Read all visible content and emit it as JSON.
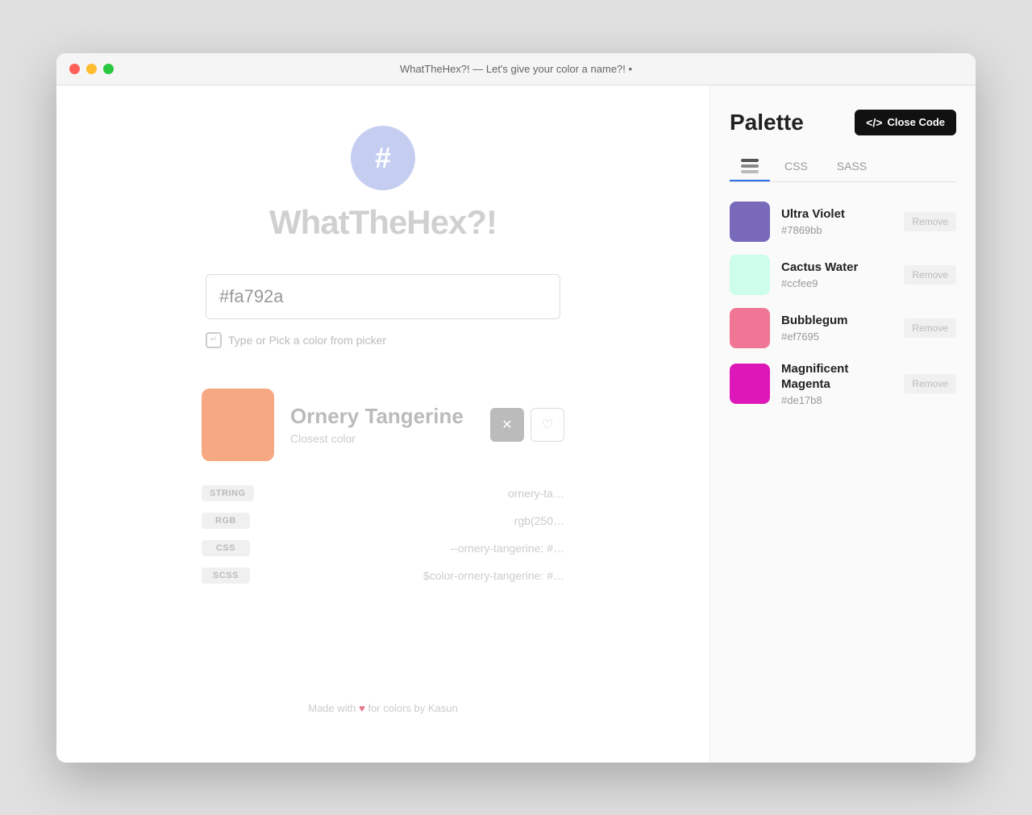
{
  "window": {
    "title": "WhatTheHex?! — Let's give your color a name?! •"
  },
  "titlebar": {
    "close_label": "",
    "min_label": "",
    "max_label": ""
  },
  "logo": {
    "symbol": "#"
  },
  "app": {
    "title": "WhatTheHex?!"
  },
  "input": {
    "value": "#fa792a",
    "placeholder": "#fa792a"
  },
  "hint": {
    "text": "Type or Pick a color from picker"
  },
  "color_result": {
    "name": "Ornery Tangerine",
    "subtitle": "Closest color",
    "swatch_color": "#f5a882",
    "string_label": "STRING",
    "string_value": "ornery-ta…",
    "rgb_label": "RGB",
    "rgb_value": "rgb(250…",
    "css_label": "CSS",
    "css_value": "--ornery-tangerine: #…",
    "scss_label": "SCSS",
    "scss_value": "$color-ornery-tangerine: #…"
  },
  "footer": {
    "text_before": "Made with",
    "text_after": "for colors by Kasun"
  },
  "right_panel": {
    "palette_title": "Palette",
    "close_code_btn_label": "Close Code",
    "tabs": [
      {
        "id": "layers",
        "type": "icon",
        "active": true
      },
      {
        "id": "css",
        "label": "CSS",
        "active": false
      },
      {
        "id": "sass",
        "label": "SASS",
        "active": false
      }
    ],
    "colors": [
      {
        "name": "Ultra Violet",
        "hex": "#7869bb",
        "swatch_color": "#7869bb",
        "remove_label": "Remove"
      },
      {
        "name": "Cactus Water",
        "hex": "#ccfee9",
        "swatch_color": "#ccfee9",
        "remove_label": "Remove"
      },
      {
        "name": "Bubblegum",
        "hex": "#ef7695",
        "swatch_color": "#ef7695",
        "remove_label": "Remove"
      },
      {
        "name": "Magnificent Magenta",
        "hex": "#de17b8",
        "swatch_color": "#de17b8",
        "remove_label": "Remove"
      }
    ]
  }
}
